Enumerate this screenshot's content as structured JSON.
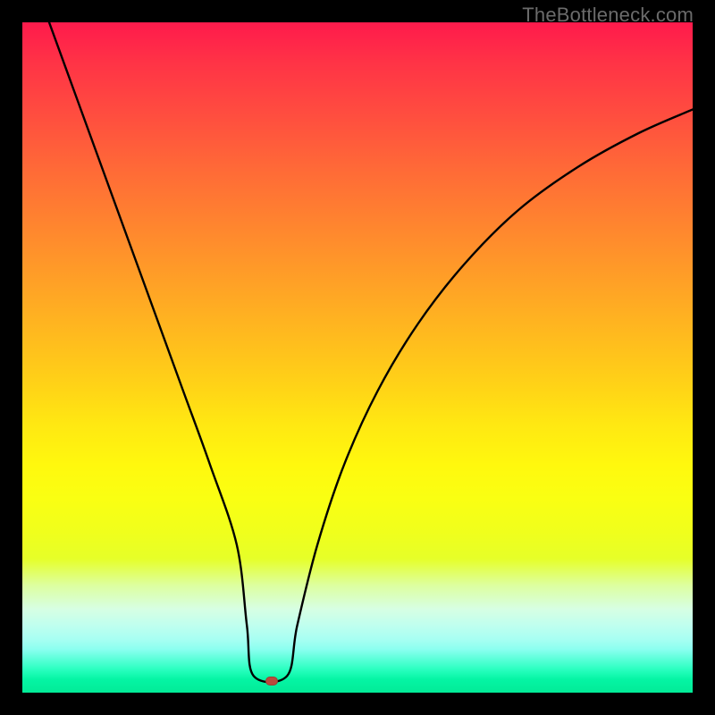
{
  "watermark": "TheBottleneck.com",
  "marker": {
    "x_frac": 0.372,
    "y_frac": 0.983
  },
  "chart_data": {
    "type": "line",
    "title": "",
    "xlabel": "",
    "ylabel": "",
    "xlim": [
      0,
      1
    ],
    "ylim": [
      0,
      1
    ],
    "curve": {
      "left_branch": [
        {
          "x": 0.04,
          "y": 1.0
        },
        {
          "x": 0.08,
          "y": 0.89
        },
        {
          "x": 0.12,
          "y": 0.78
        },
        {
          "x": 0.16,
          "y": 0.67
        },
        {
          "x": 0.2,
          "y": 0.56
        },
        {
          "x": 0.24,
          "y": 0.45
        },
        {
          "x": 0.28,
          "y": 0.34
        },
        {
          "x": 0.32,
          "y": 0.22
        },
        {
          "x": 0.335,
          "y": 0.1
        },
        {
          "x": 0.345,
          "y": 0.025
        }
      ],
      "flat_minimum": [
        {
          "x": 0.345,
          "y": 0.025
        },
        {
          "x": 0.395,
          "y": 0.025
        }
      ],
      "right_branch": [
        {
          "x": 0.395,
          "y": 0.025
        },
        {
          "x": 0.41,
          "y": 0.1
        },
        {
          "x": 0.44,
          "y": 0.22
        },
        {
          "x": 0.48,
          "y": 0.34
        },
        {
          "x": 0.53,
          "y": 0.45
        },
        {
          "x": 0.59,
          "y": 0.55
        },
        {
          "x": 0.66,
          "y": 0.64
        },
        {
          "x": 0.74,
          "y": 0.72
        },
        {
          "x": 0.83,
          "y": 0.785
        },
        {
          "x": 0.92,
          "y": 0.835
        },
        {
          "x": 1.0,
          "y": 0.87
        }
      ]
    },
    "gradient_stops": [
      {
        "pos": 0.0,
        "color": "#02eb97"
      },
      {
        "pos": 0.04,
        "color": "#2bffc0"
      },
      {
        "pos": 0.08,
        "color": "#8cfff0"
      },
      {
        "pos": 0.12,
        "color": "#d7ffe3"
      },
      {
        "pos": 0.18,
        "color": "#e6ff28"
      },
      {
        "pos": 0.3,
        "color": "#fff80e"
      },
      {
        "pos": 0.46,
        "color": "#ffd217"
      },
      {
        "pos": 0.62,
        "color": "#ff9e27"
      },
      {
        "pos": 0.78,
        "color": "#ff6a37"
      },
      {
        "pos": 0.9,
        "color": "#ff3346"
      },
      {
        "pos": 1.0,
        "color": "#ff1a4c"
      }
    ]
  }
}
